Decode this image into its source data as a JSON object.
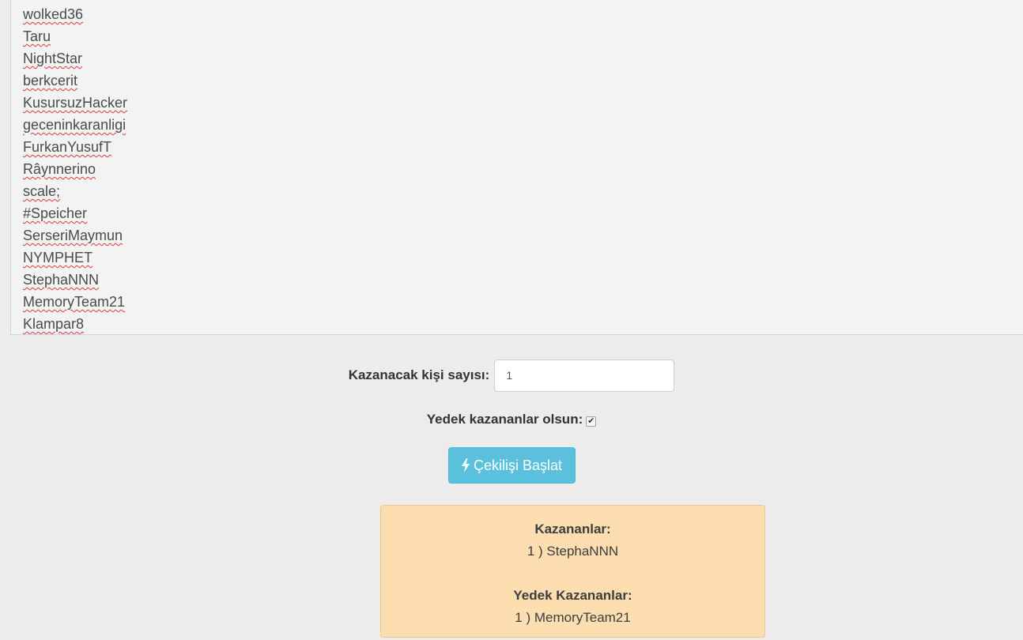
{
  "participants": [
    "wolked36",
    "Taru",
    "NightStar",
    "berkcerit",
    "KusursuzHacker",
    "geceninkaranligi",
    "FurkanYusufT",
    "Râynnerino",
    "scale;",
    "#Speicher",
    "SerseriMaymun",
    "NYMPHET",
    "StephaNNN",
    "MemoryTeam21",
    "Klampar8"
  ],
  "form": {
    "winner_count_label": "Kazanacak kişi sayısı:",
    "winner_count_value": "1",
    "backup_label": "Yedek kazananlar olsun:",
    "backup_checked": true,
    "start_button_label": "Çekilişi Başlat",
    "start_button_icon": "bolt-icon"
  },
  "results": {
    "winners_heading": "Kazananlar:",
    "winners": [
      "1 ) StephaNNN"
    ],
    "backup_heading": "Yedek Kazananlar:",
    "backups": [
      "1 ) MemoryTeam21"
    ]
  },
  "colors": {
    "button_bg": "#5bc0de",
    "result_bg": "#fcdeb0",
    "spellcheck_underline": "#e0363a"
  }
}
